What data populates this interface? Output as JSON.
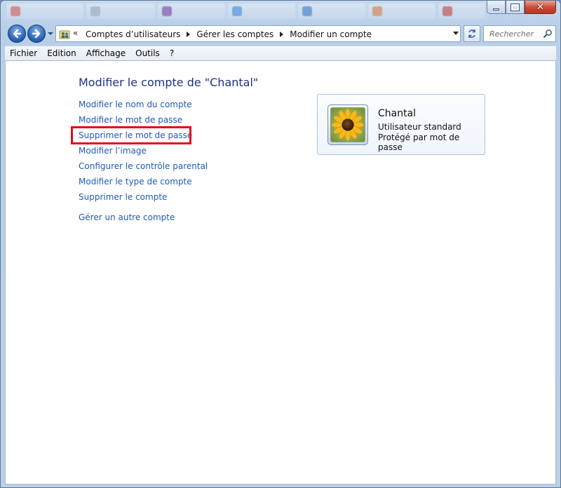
{
  "window": {
    "ghost_tabs": [
      {
        "color": "#d9534f"
      },
      {
        "color": "#9aa8bd"
      },
      {
        "color": "#7b3aa0"
      },
      {
        "color": "#3a8bd6"
      },
      {
        "color": "#3a78c4"
      },
      {
        "color": "#e07a3a"
      },
      {
        "color": "#c83a3a"
      }
    ]
  },
  "nav": {
    "breadcrumbs": [
      "Comptes d’utilisateurs",
      "Gérer les comptes",
      "Modifier un compte"
    ],
    "overflow_glyph": "«",
    "search_placeholder": "Rechercher"
  },
  "menu": [
    "Fichier",
    "Edition",
    "Affichage",
    "Outils",
    "?"
  ],
  "main": {
    "title": "Modifier le compte de \"Chantal\"",
    "tasks": [
      "Modifier le nom du compte",
      "Modifier le mot de passe",
      "Supprimer le mot de passe",
      "Modifier l’image",
      "Configurer le contrôle parental",
      "Modifier le type de compte",
      "Supprimer le compte"
    ],
    "other_task": "Gérer un autre compte",
    "highlighted_task_index": 2,
    "highlight_color": "#e3101a",
    "link_color": "#1e5ab6",
    "title_color": "#1e3287"
  },
  "user": {
    "name": "Chantal",
    "type": "Utilisateur standard",
    "status": "Protégé par mot de passe",
    "avatar": "sunflower-image"
  }
}
